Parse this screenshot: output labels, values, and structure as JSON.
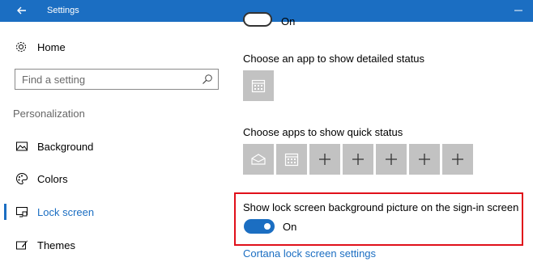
{
  "window": {
    "title": "Settings"
  },
  "sidebar": {
    "home_label": "Home",
    "search_placeholder": "Find a setting",
    "section_title": "Personalization",
    "items": [
      {
        "label": "Background",
        "icon": "image-icon",
        "active": false
      },
      {
        "label": "Colors",
        "icon": "palette-icon",
        "active": false
      },
      {
        "label": "Lock screen",
        "icon": "lock-screen-icon",
        "active": true
      },
      {
        "label": "Themes",
        "icon": "brush-icon",
        "active": false
      }
    ]
  },
  "main": {
    "top_toggle_state": "On",
    "detailed_status_heading": "Choose an app to show detailed status",
    "quick_status_heading": "Choose apps to show quick status",
    "sign_in_bg": {
      "label": "Show lock screen background picture on the sign-in screen",
      "state": "On"
    },
    "cortana_link": "Cortana lock screen settings"
  },
  "colors": {
    "accent": "#1b6ec2",
    "highlight_border": "#e0101a",
    "tile_bg": "#c2c2c2"
  }
}
